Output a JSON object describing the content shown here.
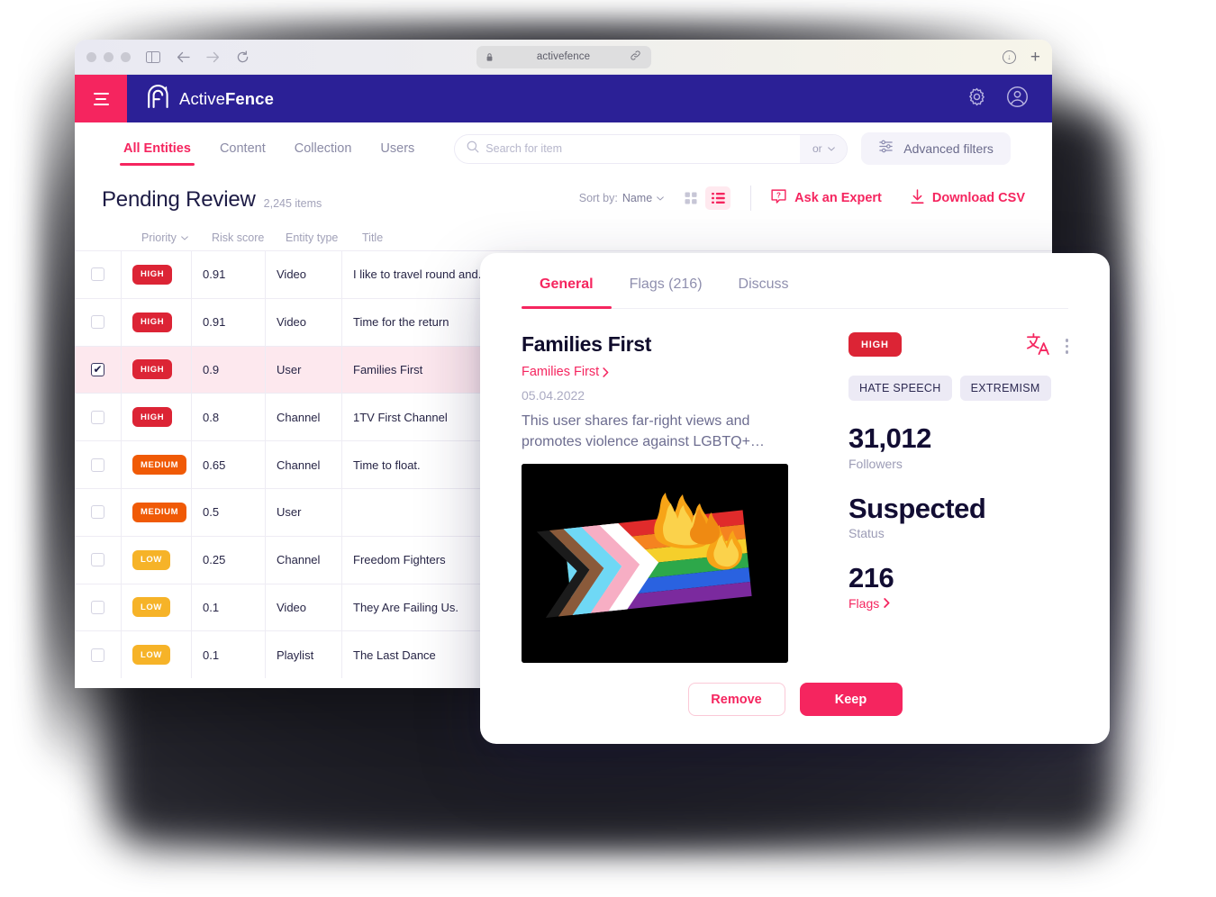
{
  "browser": {
    "url": "activefence",
    "back_icon": "arrow-left-icon",
    "forward_icon": "arrow-right-icon",
    "reload_icon": "reload-icon",
    "sidebar_icon": "sidebar-toggle-icon",
    "lock_icon": "lock-icon",
    "share_icon": "share-link-icon",
    "download_icon": "download-icon",
    "newtab_icon": "plus-icon"
  },
  "appbar": {
    "menu_icon": "hamburger-menu-icon",
    "logo_icon": "activefence-logo-icon",
    "brand_light": "Active",
    "brand_bold": "Fence",
    "settings_icon": "gear-icon",
    "account_icon": "user-avatar-icon",
    "bg_color": "#2b2096",
    "accent_color": "#f5255f"
  },
  "nav": {
    "tabs": [
      {
        "label": "All Entities",
        "active": true
      },
      {
        "label": "Content",
        "active": false
      },
      {
        "label": "Collection",
        "active": false
      },
      {
        "label": "Users",
        "active": false
      }
    ],
    "search": {
      "placeholder": "Search for item",
      "value": "",
      "icon": "search-icon"
    },
    "operator": {
      "label": "or",
      "icon": "chevron-down-icon"
    },
    "advanced_filters": {
      "label": "Advanced filters",
      "icon": "filter-sliders-icon"
    }
  },
  "page": {
    "title": "Pending Review",
    "count": "2,245 items",
    "sort_prefix": "Sort by:",
    "sort_value": "Name",
    "sort_caret_icon": "caret-down-icon",
    "grid_view_icon": "grid-view-icon",
    "list_view_icon": "list-view-icon",
    "ask_expert": {
      "label": "Ask an Expert",
      "icon": "question-bubble-icon"
    },
    "download_csv": {
      "label": "Download CSV",
      "icon": "download-arrow-icon"
    }
  },
  "table": {
    "headers": [
      "",
      "Priority",
      "Risk score",
      "Entity type",
      "Title"
    ],
    "priority_sort_icon": "chevron-down-icon",
    "rows": [
      {
        "checked": false,
        "priority": "HIGH",
        "risk": "0.91",
        "entity": "Video",
        "title": "I like to travel round and."
      },
      {
        "checked": false,
        "priority": "HIGH",
        "risk": "0.91",
        "entity": "Video",
        "title": "Time for the return"
      },
      {
        "checked": true,
        "priority": "HIGH",
        "risk": "0.9",
        "entity": "User",
        "title": "Families First"
      },
      {
        "checked": false,
        "priority": "HIGH",
        "risk": "0.8",
        "entity": "Channel",
        "title": "1TV First Channel"
      },
      {
        "checked": false,
        "priority": "MEDIUM",
        "risk": "0.65",
        "entity": "Channel",
        "title": "Time to float."
      },
      {
        "checked": false,
        "priority": "MEDIUM",
        "risk": "0.5",
        "entity": "User",
        "title": ""
      },
      {
        "checked": false,
        "priority": "LOW",
        "risk": "0.25",
        "entity": "Channel",
        "title": "Freedom Fighters"
      },
      {
        "checked": false,
        "priority": "LOW",
        "risk": "0.1",
        "entity": "Video",
        "title": "They Are Failing Us."
      },
      {
        "checked": false,
        "priority": "LOW",
        "risk": "0.1",
        "entity": "Playlist",
        "title": "The Last Dance"
      }
    ]
  },
  "modal": {
    "tabs": [
      {
        "label": "General",
        "active": true
      },
      {
        "label": "Flags (216)",
        "active": false
      },
      {
        "label": "Discuss",
        "active": false
      }
    ],
    "entity": {
      "title": "Families First",
      "link": "Families First",
      "link_icon": "chevron-right-icon",
      "date": "05.04.2022",
      "description": "This user shares far-right views and promotes violence against LGBTQ+…",
      "image_alt": "burning-progress-pride-flag-image"
    },
    "priority": "HIGH",
    "translate_icon": "translate-icon",
    "more_icon": "kebab-menu-icon",
    "categories": [
      "HATE SPEECH",
      "EXTREMISM"
    ],
    "stats": [
      {
        "value": "31,012",
        "label": "Followers",
        "link": false
      },
      {
        "value": "Suspected",
        "label": "Status",
        "link": false
      },
      {
        "value": "216",
        "label": "Flags",
        "link": true,
        "icon": "chevron-right-icon"
      }
    ],
    "actions": {
      "remove": "Remove",
      "keep": "Keep"
    }
  }
}
